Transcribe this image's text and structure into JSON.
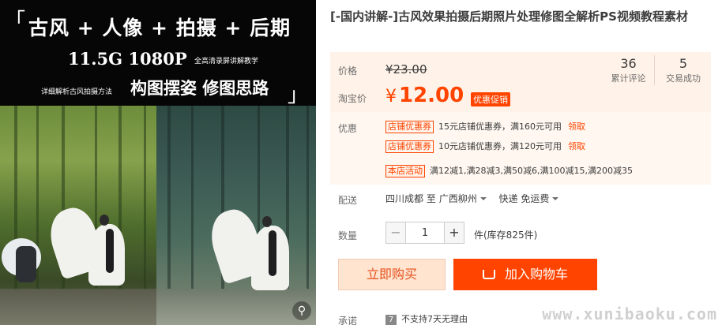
{
  "gallery": {
    "banner": {
      "title": "古风 + 人像 + 拍摄 + 后期",
      "spec": "11.5G 1080P",
      "spec_note": "全高清录屏讲解教学",
      "method": "详细解析古风拍摄方法",
      "subtitle": "构图摆姿 修图思路",
      "bracket_open": "「",
      "bracket_close": "」"
    },
    "zoom_icon": "magnifier-icon"
  },
  "product": {
    "title": "[-国内讲解-]古风效果拍摄后期照片处理修图全解析PS视频教程素材"
  },
  "price": {
    "label": "价格",
    "original": "¥23.00",
    "taobao_label": "淘宝价",
    "currency": "¥",
    "taobao_value": "12.00",
    "promo_tag": "优惠促销"
  },
  "stats": [
    {
      "value": "36",
      "caption": "累计评论"
    },
    {
      "value": "5",
      "caption": "交易成功"
    }
  ],
  "promotions": {
    "label": "优惠",
    "items": [
      {
        "tag": "店铺优惠券",
        "text": "15元店铺优惠券，满160元可用",
        "link": "领取"
      },
      {
        "tag": "店铺优惠券",
        "text": "10元店铺优惠券，满120元可用",
        "link": "领取"
      },
      {
        "tag": "本店活动",
        "text": "满12减1,满28减3,满50减6,满100减15,满200减35"
      }
    ]
  },
  "shipping": {
    "label": "配送",
    "origin": "四川成都",
    "to_word": "至",
    "destination": "广西柳州",
    "method": "快递 免运费"
  },
  "quantity": {
    "label": "数量",
    "minus": "−",
    "value": "1",
    "plus": "+",
    "stock": "件(库存825件)"
  },
  "actions": {
    "buy_now": "立即购买",
    "add_to_cart": "加入购物车"
  },
  "promise": {
    "label": "承诺",
    "badge": "7",
    "text": "不支持7天无理由"
  },
  "watermark": "www.xunibaoku.com",
  "colors": {
    "accent": "#ff4400",
    "price_bg": "#fff2e8",
    "buy_now_bg": "#ffe4d0"
  }
}
